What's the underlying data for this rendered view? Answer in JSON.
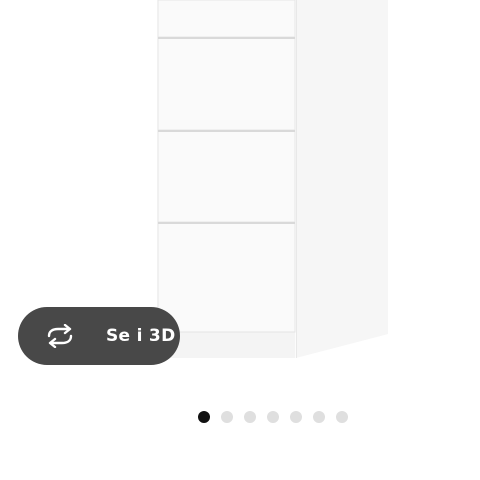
{
  "view_3d": {
    "label": "Se i 3D",
    "icon": "rotate-3d-icon"
  },
  "carousel": {
    "total_images": 7,
    "active_index": 0
  },
  "colors": {
    "button_background": "#484848",
    "dot_active": "#111111",
    "dot_inactive": "#dfdfdf"
  }
}
